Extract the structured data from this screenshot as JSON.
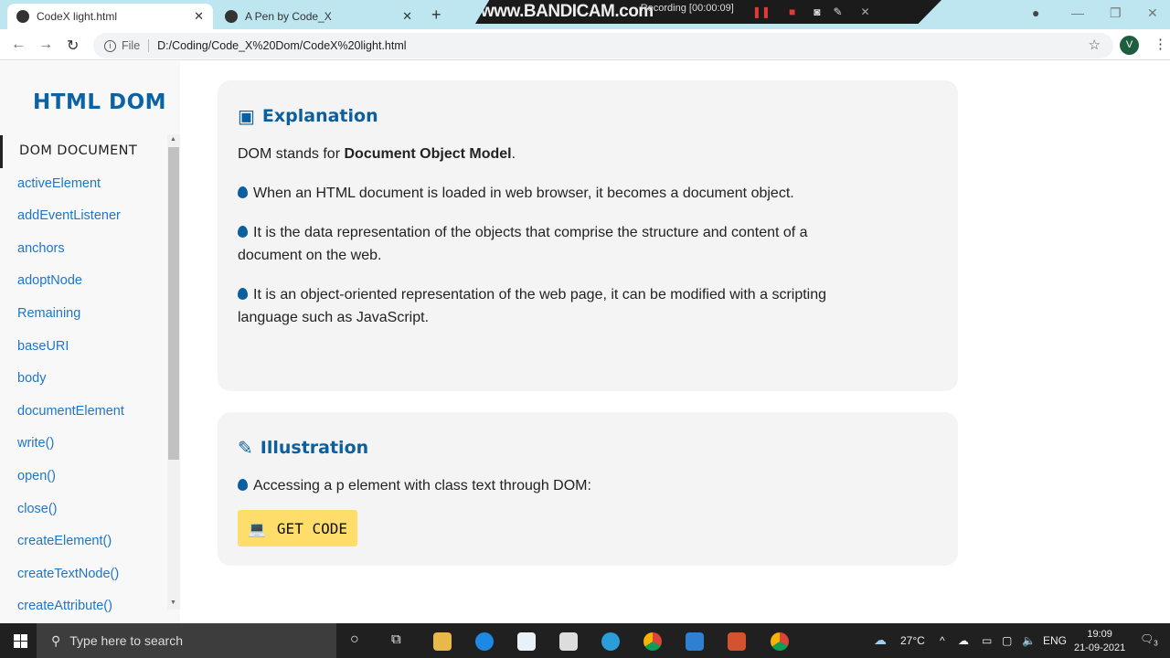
{
  "browser": {
    "tabs": [
      {
        "title": "CodeX light.html",
        "active": true
      },
      {
        "title": "A Pen by Code_X",
        "active": false
      }
    ],
    "url_scheme": "File",
    "url": "D:/Coding/Code_X%20Dom/CodeX%20light.html",
    "profile_initial": "V"
  },
  "recorder": {
    "logo": "www.BANDICAM.com",
    "status": "Recording [00:00:09]"
  },
  "sidebar": {
    "title": "HTML DOM",
    "items": [
      "DOM DOCUMENT",
      "activeElement",
      "addEventListener",
      "anchors",
      "adoptNode",
      "Remaining",
      "baseURI",
      "body",
      "documentElement",
      "write()",
      "open()",
      "close()",
      "createElement()",
      "createTextNode()",
      "createAttribute()"
    ]
  },
  "explanation": {
    "heading": "Explanation",
    "intro_prefix": "DOM stands for ",
    "intro_bold": "Document Object Model",
    "intro_suffix": ".",
    "points": [
      "When an HTML document is loaded in web browser, it becomes a document object.",
      "It is the data representation of the objects that comprise the structure and content of a document on the web.",
      "It is an object-oriented representation of the web page, it can be modified with a scripting language such as JavaScript."
    ]
  },
  "illustration": {
    "heading": "Illustration",
    "text": "Accessing a p element with class text through DOM:",
    "button": "GET CODE"
  },
  "taskbar": {
    "search_placeholder": "Type here to search",
    "weather": "27°C",
    "language": "ENG",
    "time": "19:09",
    "date": "21-09-2021",
    "notifications": "3"
  },
  "colors": {
    "accent": "#0c5f9e",
    "link": "#1d76c9",
    "button": "#ffdd6b",
    "card": "#f4f4f4"
  }
}
